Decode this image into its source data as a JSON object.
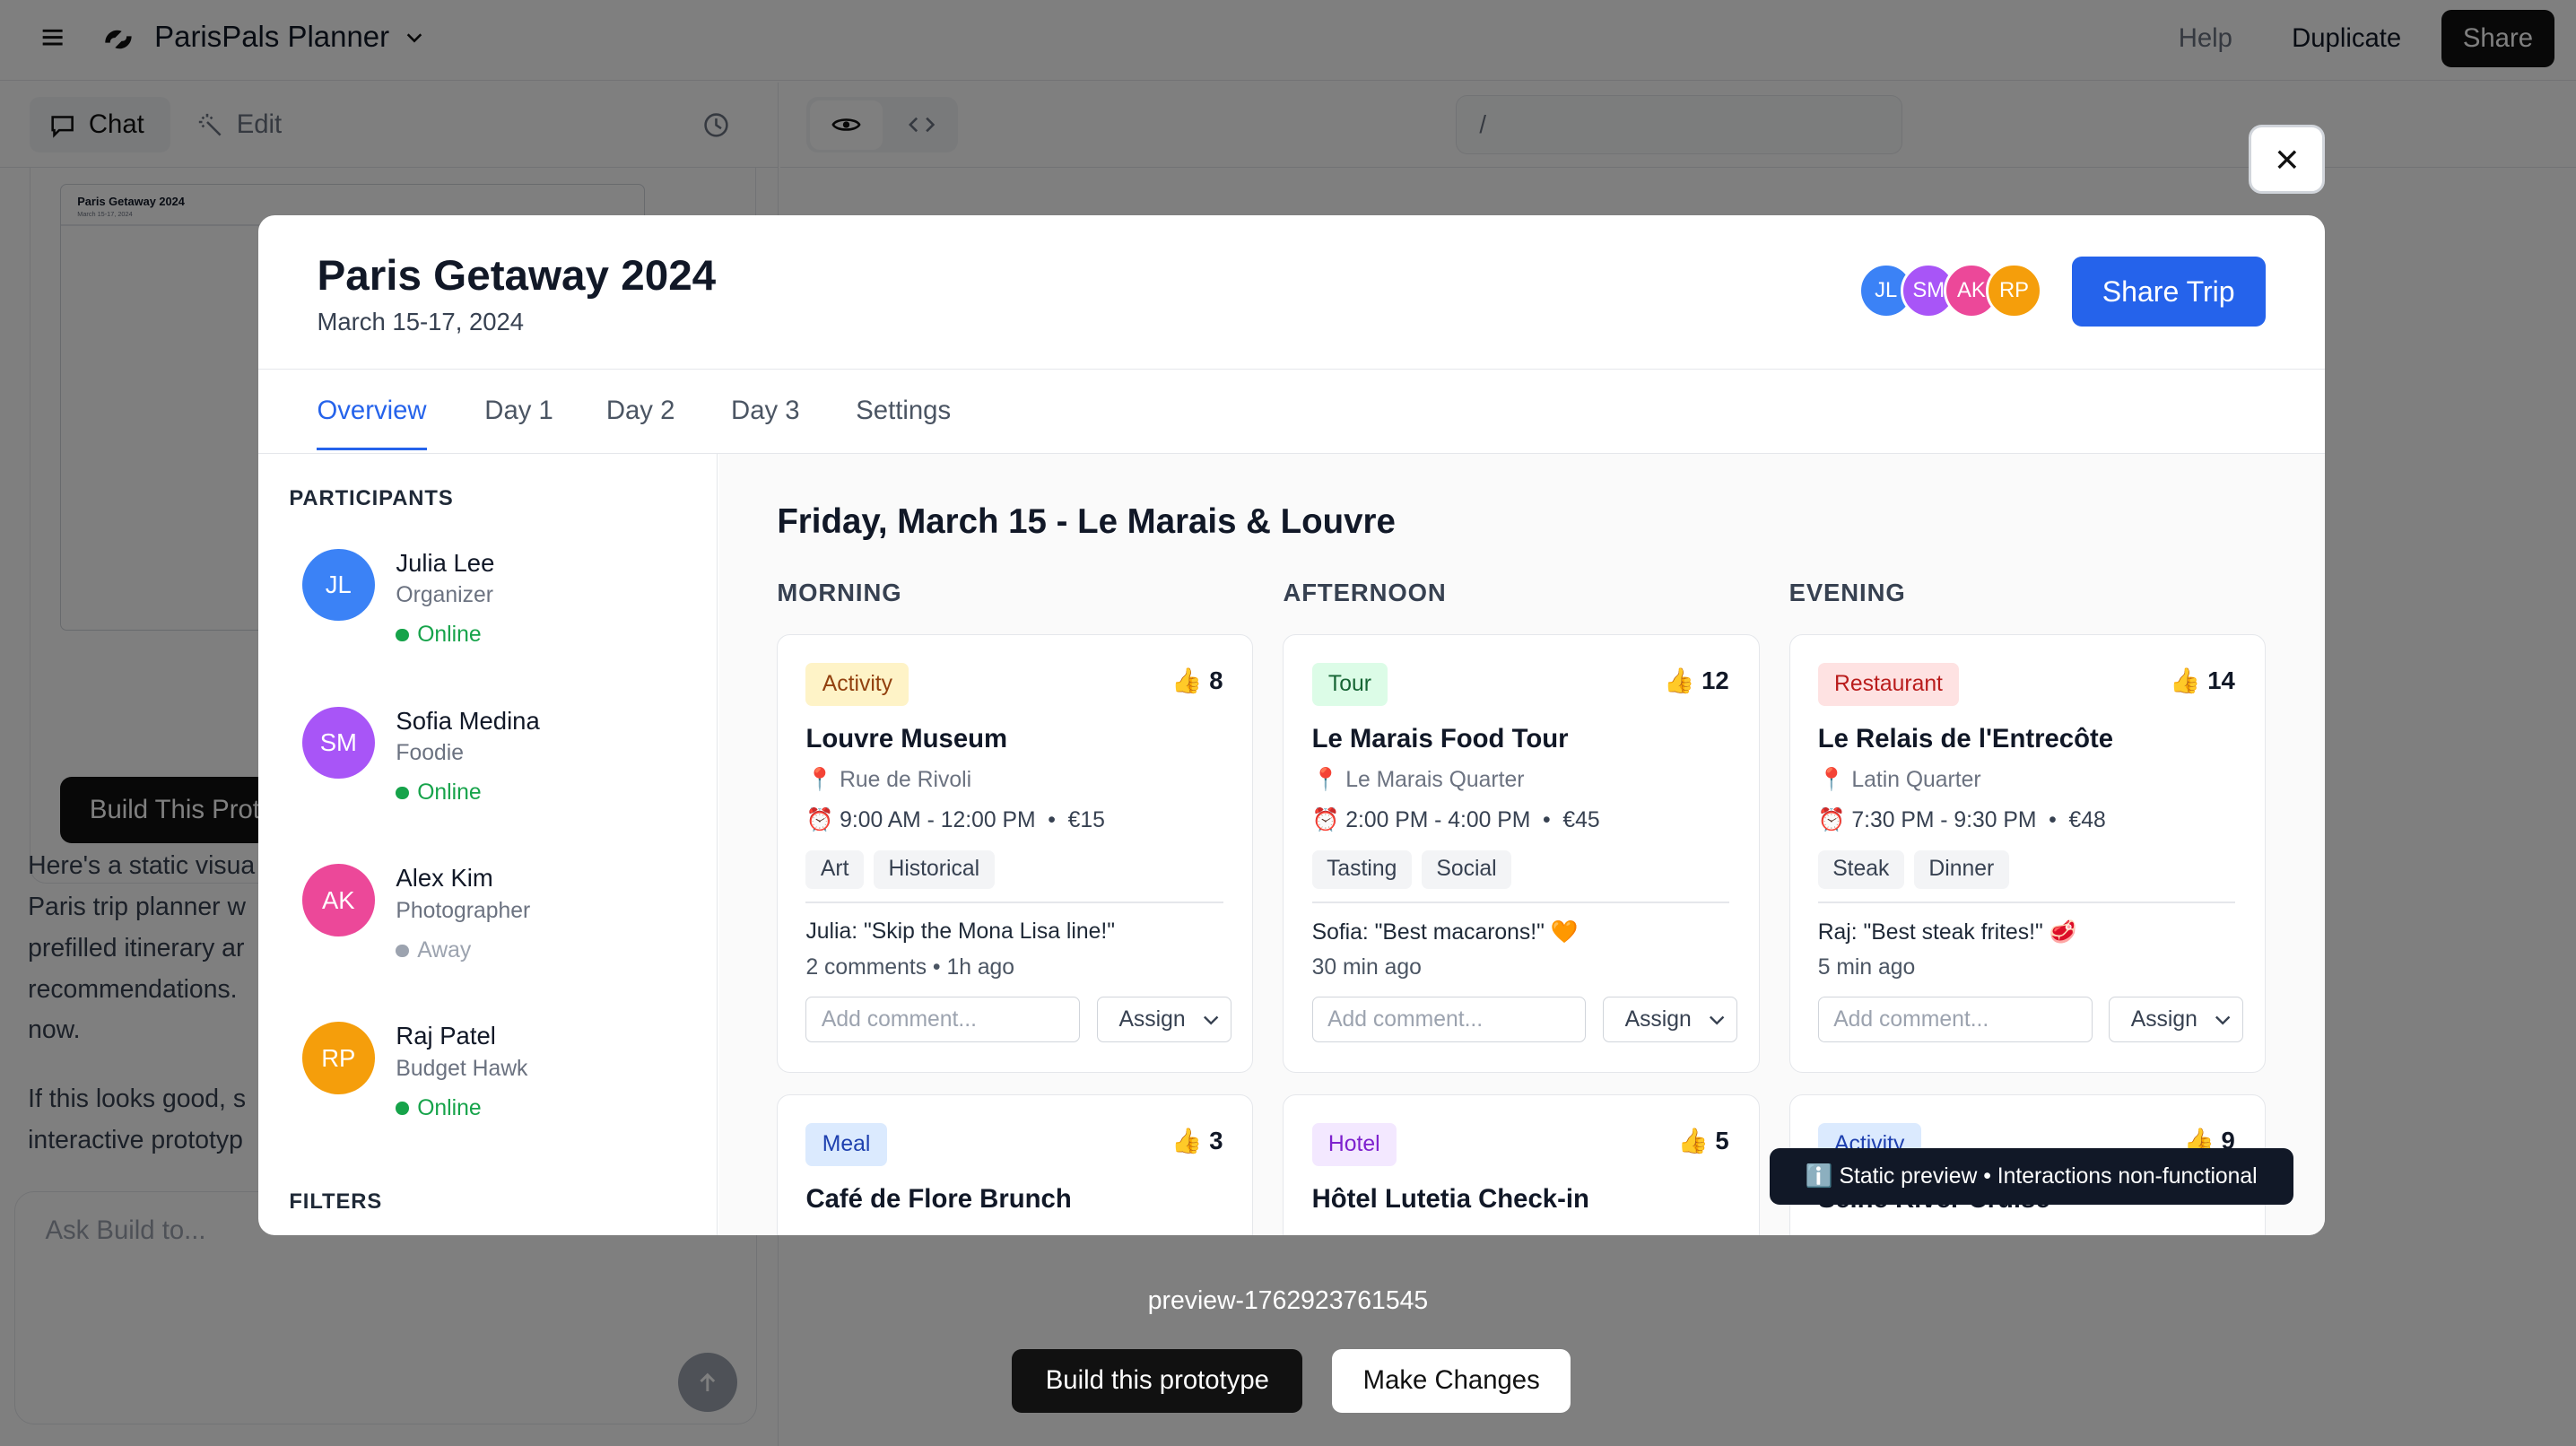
{
  "app": {
    "title": "ParisPals Planner",
    "help": "Help",
    "duplicate": "Duplicate",
    "share": "Share"
  },
  "left_panel": {
    "tabs": {
      "chat": "Chat",
      "edit": "Edit"
    },
    "thumbnail": {
      "title": "Paris Getaway 2024",
      "date": "March 15-17, 2024"
    },
    "build_button": "Build This Prot",
    "messages": [
      "Here's a static visua\nParis trip planner w\nprefilled itinerary ar\nrecommendations.\nnow.",
      "If this looks good, s\ninteractive prototyp"
    ],
    "input_placeholder": "Ask Build to..."
  },
  "preview_toolbar": {
    "url": "/"
  },
  "modal": {
    "title": "Paris Getaway 2024",
    "date": "March 15-17, 2024",
    "avatars": [
      {
        "initials": "JL",
        "color": "#3b82f6"
      },
      {
        "initials": "SM",
        "color": "#a855f7"
      },
      {
        "initials": "AK",
        "color": "#ec4899"
      },
      {
        "initials": "RP",
        "color": "#f59e0b"
      }
    ],
    "share_trip": "Share Trip",
    "tabs": [
      "Overview",
      "Day 1",
      "Day 2",
      "Day 3",
      "Settings"
    ],
    "participants_label": "PARTICIPANTS",
    "participants": [
      {
        "initials": "JL",
        "name": "Julia Lee",
        "role": "Organizer",
        "status": "Online",
        "color": "#3b82f6",
        "status_color": "#16a34a"
      },
      {
        "initials": "SM",
        "name": "Sofia Medina",
        "role": "Foodie",
        "status": "Online",
        "color": "#a855f7",
        "status_color": "#16a34a"
      },
      {
        "initials": "AK",
        "name": "Alex Kim",
        "role": "Photographer",
        "status": "Away",
        "color": "#ec4899",
        "status_color": "#9ca3af"
      },
      {
        "initials": "RP",
        "name": "Raj Patel",
        "role": "Budget Hawk",
        "status": "Online",
        "color": "#f59e0b",
        "status_color": "#16a34a"
      }
    ],
    "filters_label": "FILTERS",
    "day_title": "Friday, March 15 - Le Marais & Louvre",
    "columns": [
      "MORNING",
      "AFTERNOON",
      "EVENING"
    ],
    "cards": [
      {
        "tag": "Activity",
        "tag_bg": "#fef3c7",
        "tag_fg": "#92400e",
        "votes": "👍 8",
        "title": "Louvre Museum",
        "location": "📍 Rue de Rivoli",
        "time": "⏰ 9:00 AM - 12:00 PM  •  €15",
        "tags": [
          "Art",
          "Historical"
        ],
        "quote": "Julia: \"Skip the Mona Lisa line!\"",
        "meta": "2 comments • 1h ago",
        "comment_ph": "Add comment...",
        "assign": "Assign"
      },
      {
        "tag": "Tour",
        "tag_bg": "#dcfce7",
        "tag_fg": "#166534",
        "votes": "👍 12",
        "title": "Le Marais Food Tour",
        "location": "📍 Le Marais Quarter",
        "time": "⏰ 2:00 PM - 4:00 PM  •  €45",
        "tags": [
          "Tasting",
          "Social"
        ],
        "quote": "Sofia: \"Best macarons!\" 🧡",
        "meta": "30 min ago",
        "comment_ph": "Add comment...",
        "assign": "Assign"
      },
      {
        "tag": "Restaurant",
        "tag_bg": "#fee2e2",
        "tag_fg": "#b91c1c",
        "votes": "👍 14",
        "title": "Le Relais de l'Entrecôte",
        "location": "📍 Latin Quarter",
        "time": "⏰ 7:30 PM - 9:30 PM  •  €48",
        "tags": [
          "Steak",
          "Dinner"
        ],
        "quote": "Raj: \"Best steak frites!\" 🥩",
        "meta": "5 min ago",
        "comment_ph": "Add comment...",
        "assign": "Assign"
      }
    ],
    "cards_row2": [
      {
        "tag": "Meal",
        "tag_bg": "#dbeafe",
        "tag_fg": "#1e40af",
        "votes": "👍 3",
        "title": "Café de Flore Brunch"
      },
      {
        "tag": "Hotel",
        "tag_bg": "#f3e8ff",
        "tag_fg": "#7e22ce",
        "votes": "👍 5",
        "title": "Hôtel Lutetia Check-in"
      },
      {
        "tag": "Activity",
        "tag_bg": "#dbeafe",
        "tag_fg": "#1e40af",
        "votes": "👍 9",
        "title": "Seine River Cruise"
      }
    ]
  },
  "toast": "ℹ️ Static preview • Interactions non-functional",
  "preview_id": "preview-1762923761545",
  "buttons": {
    "build": "Build this prototype",
    "changes": "Make Changes"
  }
}
